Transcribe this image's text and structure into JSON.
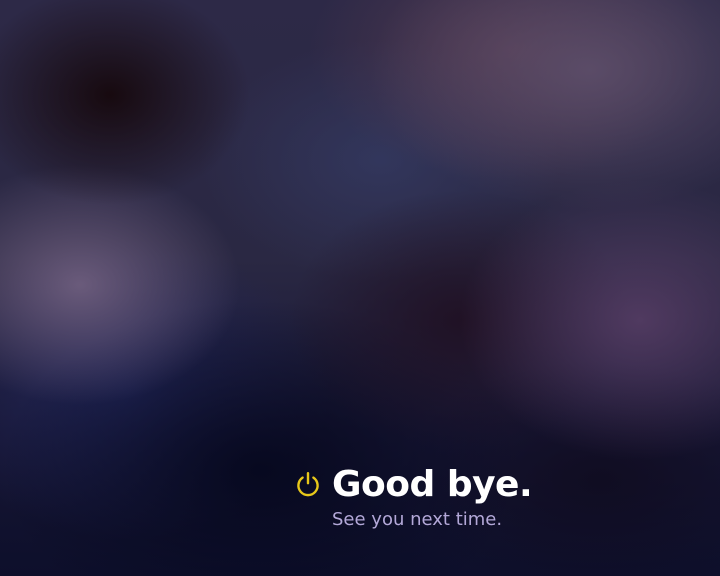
{
  "logout": {
    "title": "Good bye.",
    "subtitle": "See you next time.",
    "icon": "power-icon",
    "icon_color": "#e8c81a"
  },
  "colors": {
    "title": "#ffffff",
    "subtitle": "#b3a8d8"
  }
}
